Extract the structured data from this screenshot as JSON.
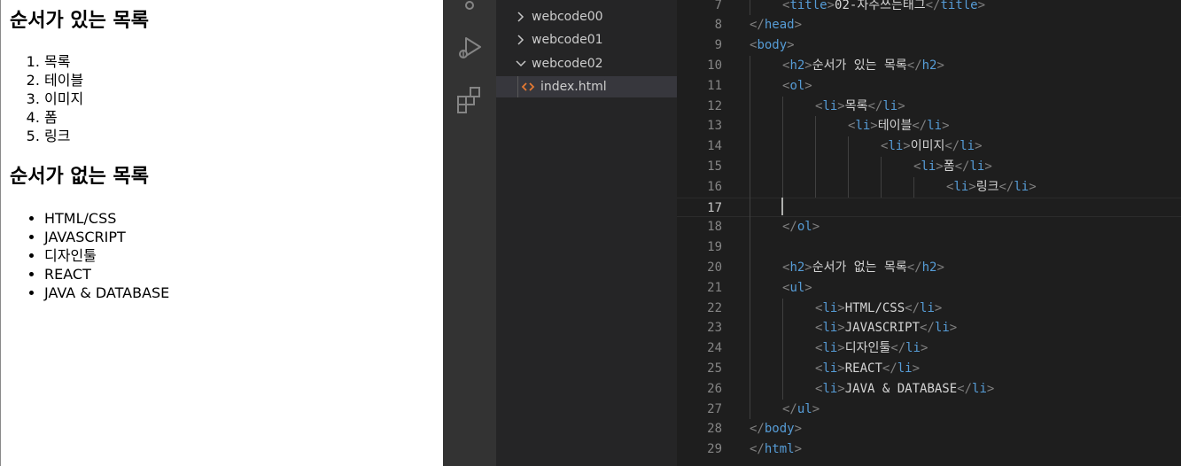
{
  "preview": {
    "ordered_heading": "순서가 있는 목록",
    "ordered_items": [
      "목록",
      "테이블",
      "이미지",
      "폼",
      "링크"
    ],
    "unordered_heading": "순서가 없는 목록",
    "unordered_items": [
      "HTML/CSS",
      "JAVASCRIPT",
      "디자인툴",
      "REACT",
      "JAVA & DATABASE"
    ]
  },
  "activity_bar": {
    "icons": [
      "source-control-icon",
      "run-debug-icon",
      "extensions-icon"
    ]
  },
  "explorer": {
    "folders": [
      {
        "label": "webcode00",
        "expanded": false
      },
      {
        "label": "webcode01",
        "expanded": false
      },
      {
        "label": "webcode02",
        "expanded": true
      }
    ],
    "file": {
      "label": "index.html",
      "selected": true
    }
  },
  "editor": {
    "current_line": "17",
    "lines": [
      {
        "n": "7",
        "indent": 1,
        "tokens": [
          [
            "br",
            "<"
          ],
          [
            "tag",
            "title"
          ],
          [
            "br",
            ">"
          ],
          [
            "txt",
            "02-자주쓰는태그"
          ],
          [
            "br",
            "</"
          ],
          [
            "tag",
            "title"
          ],
          [
            "br",
            ">"
          ]
        ]
      },
      {
        "n": "8",
        "indent": 0,
        "tokens": [
          [
            "br",
            "</"
          ],
          [
            "tag",
            "head"
          ],
          [
            "br",
            ">"
          ]
        ]
      },
      {
        "n": "9",
        "indent": 0,
        "tokens": [
          [
            "br",
            "<"
          ],
          [
            "tag",
            "body"
          ],
          [
            "br",
            ">"
          ]
        ]
      },
      {
        "n": "10",
        "indent": 1,
        "tokens": [
          [
            "br",
            "<"
          ],
          [
            "tag",
            "h2"
          ],
          [
            "br",
            ">"
          ],
          [
            "txt",
            "순서가 있는 목록"
          ],
          [
            "br",
            "</"
          ],
          [
            "tag",
            "h2"
          ],
          [
            "br",
            ">"
          ]
        ]
      },
      {
        "n": "11",
        "indent": 1,
        "tokens": [
          [
            "br",
            "<"
          ],
          [
            "tag",
            "ol"
          ],
          [
            "br",
            ">"
          ]
        ]
      },
      {
        "n": "12",
        "indent": 2,
        "tokens": [
          [
            "br",
            "<"
          ],
          [
            "tag",
            "li"
          ],
          [
            "br",
            ">"
          ],
          [
            "txt",
            "목록"
          ],
          [
            "br",
            "</"
          ],
          [
            "tag",
            "li"
          ],
          [
            "br",
            ">"
          ]
        ]
      },
      {
        "n": "13",
        "indent": 3,
        "tokens": [
          [
            "br",
            "<"
          ],
          [
            "tag",
            "li"
          ],
          [
            "br",
            ">"
          ],
          [
            "txt",
            "테이블"
          ],
          [
            "br",
            "</"
          ],
          [
            "tag",
            "li"
          ],
          [
            "br",
            ">"
          ]
        ]
      },
      {
        "n": "14",
        "indent": 4,
        "tokens": [
          [
            "br",
            "<"
          ],
          [
            "tag",
            "li"
          ],
          [
            "br",
            ">"
          ],
          [
            "txt",
            "이미지"
          ],
          [
            "br",
            "</"
          ],
          [
            "tag",
            "li"
          ],
          [
            "br",
            ">"
          ]
        ]
      },
      {
        "n": "15",
        "indent": 5,
        "tokens": [
          [
            "br",
            "<"
          ],
          [
            "tag",
            "li"
          ],
          [
            "br",
            ">"
          ],
          [
            "txt",
            "폼"
          ],
          [
            "br",
            "</"
          ],
          [
            "tag",
            "li"
          ],
          [
            "br",
            ">"
          ]
        ]
      },
      {
        "n": "16",
        "indent": 6,
        "tokens": [
          [
            "br",
            "<"
          ],
          [
            "tag",
            "li"
          ],
          [
            "br",
            ">"
          ],
          [
            "txt",
            "링크"
          ],
          [
            "br",
            "</"
          ],
          [
            "tag",
            "li"
          ],
          [
            "br",
            ">"
          ]
        ]
      },
      {
        "n": "17",
        "indent": 0,
        "tokens": []
      },
      {
        "n": "18",
        "indent": 1,
        "tokens": [
          [
            "br",
            "</"
          ],
          [
            "tag",
            "ol"
          ],
          [
            "br",
            ">"
          ]
        ]
      },
      {
        "n": "19",
        "indent": 0,
        "tokens": []
      },
      {
        "n": "20",
        "indent": 1,
        "tokens": [
          [
            "br",
            "<"
          ],
          [
            "tag",
            "h2"
          ],
          [
            "br",
            ">"
          ],
          [
            "txt",
            "순서가 없는 목록"
          ],
          [
            "br",
            "</"
          ],
          [
            "tag",
            "h2"
          ],
          [
            "br",
            ">"
          ]
        ]
      },
      {
        "n": "21",
        "indent": 1,
        "tokens": [
          [
            "br",
            "<"
          ],
          [
            "tag",
            "ul"
          ],
          [
            "br",
            ">"
          ]
        ]
      },
      {
        "n": "22",
        "indent": 2,
        "tokens": [
          [
            "br",
            "<"
          ],
          [
            "tag",
            "li"
          ],
          [
            "br",
            ">"
          ],
          [
            "txt",
            "HTML/CSS"
          ],
          [
            "br",
            "</"
          ],
          [
            "tag",
            "li"
          ],
          [
            "br",
            ">"
          ]
        ]
      },
      {
        "n": "23",
        "indent": 2,
        "tokens": [
          [
            "br",
            "<"
          ],
          [
            "tag",
            "li"
          ],
          [
            "br",
            ">"
          ],
          [
            "txt",
            "JAVASCRIPT"
          ],
          [
            "br",
            "</"
          ],
          [
            "tag",
            "li"
          ],
          [
            "br",
            ">"
          ]
        ]
      },
      {
        "n": "24",
        "indent": 2,
        "tokens": [
          [
            "br",
            "<"
          ],
          [
            "tag",
            "li"
          ],
          [
            "br",
            ">"
          ],
          [
            "txt",
            "디자인툴"
          ],
          [
            "br",
            "</"
          ],
          [
            "tag",
            "li"
          ],
          [
            "br",
            ">"
          ]
        ]
      },
      {
        "n": "25",
        "indent": 2,
        "tokens": [
          [
            "br",
            "<"
          ],
          [
            "tag",
            "li"
          ],
          [
            "br",
            ">"
          ],
          [
            "txt",
            "REACT"
          ],
          [
            "br",
            "</"
          ],
          [
            "tag",
            "li"
          ],
          [
            "br",
            ">"
          ]
        ]
      },
      {
        "n": "26",
        "indent": 2,
        "tokens": [
          [
            "br",
            "<"
          ],
          [
            "tag",
            "li"
          ],
          [
            "br",
            ">"
          ],
          [
            "txt",
            "JAVA & DATABASE"
          ],
          [
            "br",
            "</"
          ],
          [
            "tag",
            "li"
          ],
          [
            "br",
            ">"
          ]
        ]
      },
      {
        "n": "27",
        "indent": 1,
        "tokens": [
          [
            "br",
            "</"
          ],
          [
            "tag",
            "ul"
          ],
          [
            "br",
            ">"
          ]
        ]
      },
      {
        "n": "28",
        "indent": 0,
        "tokens": [
          [
            "br",
            "</"
          ],
          [
            "tag",
            "body"
          ],
          [
            "br",
            ">"
          ]
        ]
      },
      {
        "n": "29",
        "indent": 0,
        "tokens": [
          [
            "br",
            "</"
          ],
          [
            "tag",
            "html"
          ],
          [
            "br",
            ">"
          ]
        ]
      }
    ]
  },
  "colors": {
    "tag": "#569cd6",
    "bracket": "#808080",
    "text": "#d4d4d4",
    "line_number": "#858585",
    "html_file_icon": "#e37933"
  }
}
